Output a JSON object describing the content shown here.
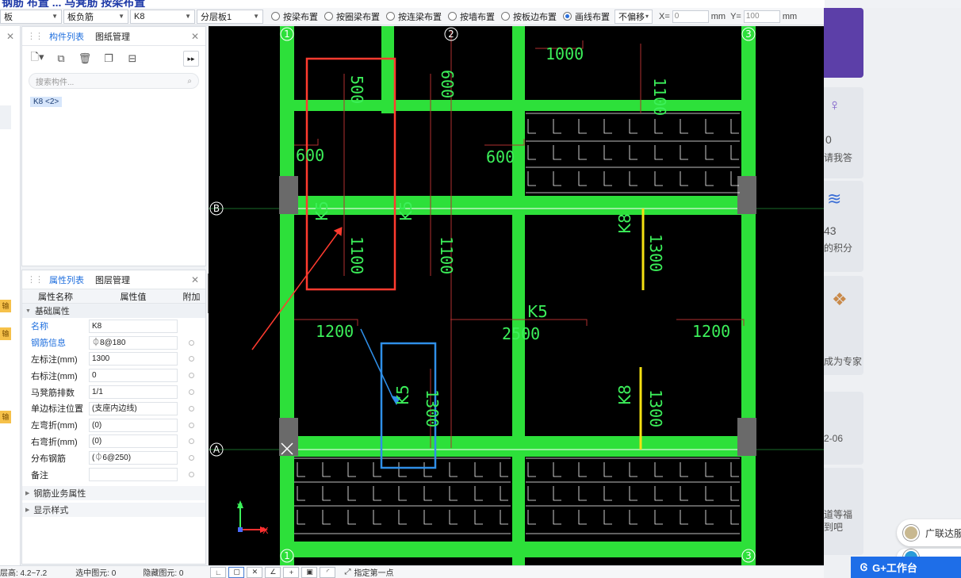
{
  "title_text": "钢筋  布置 ... 马凳筋 按梁布置",
  "toolbar": {
    "dropdowns": [
      "板",
      "板负筋",
      "K8",
      "分层板1"
    ],
    "radios": [
      {
        "label": "按梁布置",
        "checked": false
      },
      {
        "label": "按圈梁布置",
        "checked": false
      },
      {
        "label": "按连梁布置",
        "checked": false
      },
      {
        "label": "按墙布置",
        "checked": false
      },
      {
        "label": "按板边布置",
        "checked": false
      },
      {
        "label": "画线布置",
        "checked": true
      }
    ],
    "offset_select": "不偏移",
    "x_label": "X=",
    "x_value": "0",
    "x_unit": "mm",
    "y_label": "Y=",
    "y_value": "100",
    "y_unit": "mm"
  },
  "component_panel": {
    "tabs": [
      "构件列表",
      "图纸管理"
    ],
    "search_placeholder": "搜索构件...",
    "items": [
      "K8 <2>"
    ]
  },
  "property_panel": {
    "tabs": [
      "属性列表",
      "图层管理"
    ],
    "columns": [
      "属性名称",
      "属性值",
      "附加"
    ],
    "group_basic": "基础属性",
    "rows": [
      {
        "name": "名称",
        "value": "K8",
        "highlight": true
      },
      {
        "name": "钢筋信息",
        "value": "⏀8@180",
        "highlight": true
      },
      {
        "name": "左标注(mm)",
        "value": "1300",
        "highlight": false
      },
      {
        "name": "右标注(mm)",
        "value": "0",
        "highlight": false
      },
      {
        "name": "马凳筋排数",
        "value": "1/1",
        "highlight": false
      },
      {
        "name": "单边标注位置",
        "value": "(支座内边线)",
        "highlight": false
      },
      {
        "name": "左弯折(mm)",
        "value": "(0)",
        "highlight": false
      },
      {
        "name": "右弯折(mm)",
        "value": "(0)",
        "highlight": false
      },
      {
        "name": "分布钢筋",
        "value": "(⏀6@250)",
        "highlight": false
      },
      {
        "name": "备注",
        "value": "",
        "highlight": false
      }
    ],
    "group_business": "钢筋业务属性",
    "group_display": "显示样式"
  },
  "left_strip_badges": [
    "输",
    "输",
    "输"
  ],
  "canvas": {
    "axis_labels": {
      "top_left": "1",
      "top_mid": "2",
      "top_right": "3",
      "left_b": "B",
      "left_a": "A",
      "bottom_left": "1",
      "bottom_right": "3"
    },
    "dims": [
      "1000",
      "1100",
      "500",
      "600",
      "600",
      "600",
      "1100",
      "1100",
      "1300",
      "1200",
      "2500",
      "1200",
      "1300",
      "1300"
    ],
    "rebar_labels": [
      "K5",
      "K5",
      "K8",
      "K5",
      "K5",
      "K8"
    ],
    "axis_x": "X",
    "axis_y": "Y"
  },
  "status": {
    "elevation": "层高: 4.2~7.2",
    "selected": "选中图元: 0",
    "hidden": "隐藏图元: 0",
    "hint": "指定第一点"
  },
  "sidebar": {
    "count1": "0",
    "ask_me": "请我答",
    "count2": "43",
    "points": "的积分",
    "expert": "成为专家",
    "date": "2-06",
    "fortune1": "道等福",
    "fortune2": "到吧",
    "chat_label": "广联达服",
    "g_tool": "G+工作台"
  },
  "colors": {
    "accent": "#1f6fde",
    "beam_green": "#2de03a",
    "dim_red": "#c0392b",
    "label_green": "#3cf05a",
    "rebar_yellow": "#f4e112",
    "annot_red": "#ff3b2f",
    "annot_blue": "#2f8fe8"
  }
}
